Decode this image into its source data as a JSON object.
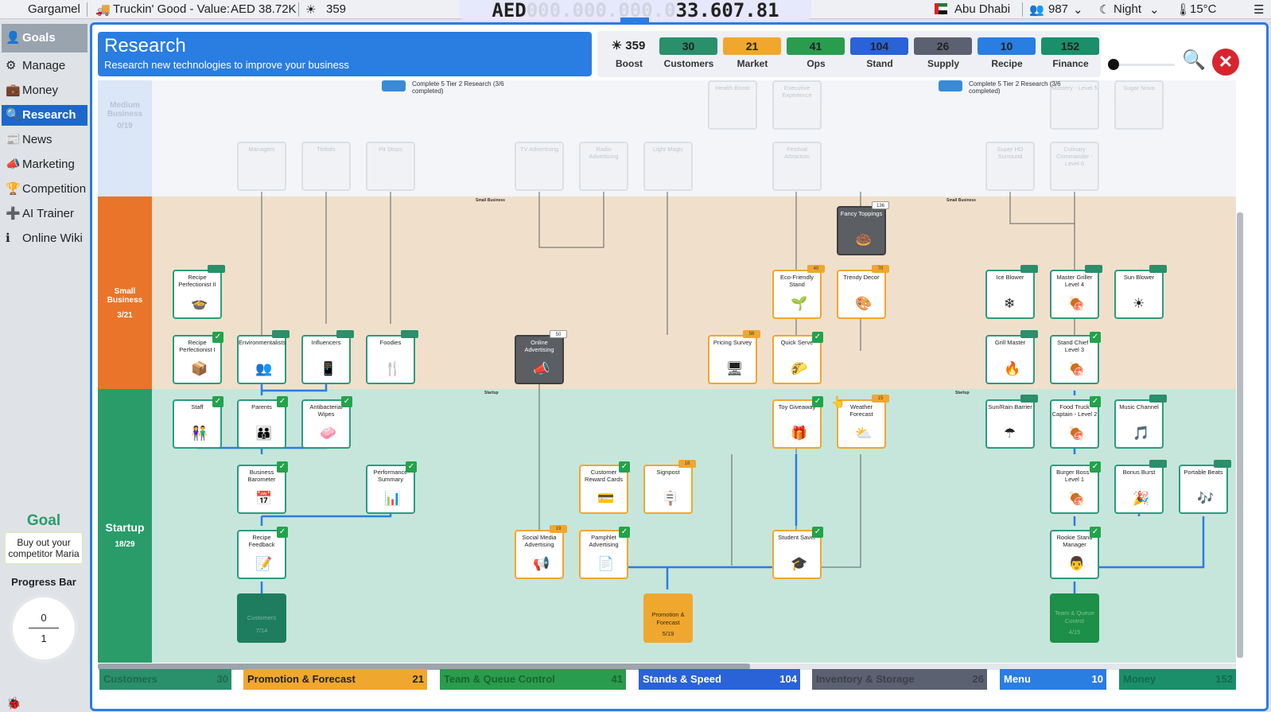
{
  "topbar": {
    "user": "Gargamel",
    "company": "Truckin' Good - Value:",
    "company_value": "AED 38.72K",
    "boost": "359",
    "money_prefix": "AED",
    "money_zeros": "000.000.000.0",
    "money_value": "33.607.81",
    "city": "Abu Dhabi",
    "visitors": "987",
    "time_of_day": "Night",
    "temperature": "15°C"
  },
  "sidebar": {
    "items": [
      {
        "label": "Goals",
        "icon": "person-icon"
      },
      {
        "label": "Manage",
        "icon": "gear-icon"
      },
      {
        "label": "Money",
        "icon": "wallet-icon"
      },
      {
        "label": "Research",
        "icon": "magnifier-icon"
      },
      {
        "label": "News",
        "icon": "newspaper-icon"
      },
      {
        "label": "Marketing",
        "icon": "megaphone-icon"
      },
      {
        "label": "Competition",
        "icon": "podium-icon"
      },
      {
        "label": "AI Trainer",
        "icon": "plus-icon"
      },
      {
        "label": "Online Wiki",
        "icon": "info-icon"
      }
    ],
    "goal_title": "Goal",
    "goal_text": "Buy out your competitor Maria",
    "progress_title": "Progress Bar",
    "progress_num": "0",
    "progress_den": "1"
  },
  "header": {
    "title": "Research",
    "subtitle": "Research new technologies to improve your business"
  },
  "stats": [
    {
      "value": "359",
      "label": "Boost",
      "color": "#eef0f5"
    },
    {
      "value": "30",
      "label": "Customers",
      "color": "#2a8f6b"
    },
    {
      "value": "21",
      "label": "Market",
      "color": "#f0a72e"
    },
    {
      "value": "41",
      "label": "Ops",
      "color": "#2a9c4e"
    },
    {
      "value": "104",
      "label": "Stand",
      "color": "#2a62d8"
    },
    {
      "value": "26",
      "label": "Supply",
      "color": "#5b6170"
    },
    {
      "value": "10",
      "label": "Recipe",
      "color": "#2a7de1"
    },
    {
      "value": "152",
      "label": "Finance",
      "color": "#1a8f6a"
    }
  ],
  "bands": {
    "medium": {
      "name": "Medium Business",
      "count": "0/19",
      "color": "#e8eef8"
    },
    "small": {
      "name": "Small Business",
      "count": "3/21",
      "color": "#e8752a"
    },
    "startup": {
      "name": "Startup",
      "count": "18/29",
      "color": "#2a9c6a"
    }
  },
  "ghost_nodes": [
    "Managers",
    "Tinfoils",
    "Pit Stops",
    "TV Advertising",
    "Radio Advertising",
    "Light Magic",
    "Festival Attraction",
    "Super HD Surround",
    "Culinary Commander - Level 6",
    "Health Boost",
    "Executive Experience",
    "Mastery - Level 5",
    "Sugar Nova"
  ],
  "nodes": [
    {
      "label": "Recipe Perfectionist II",
      "icon": "recipe-icon",
      "glyph": "🍲"
    },
    {
      "label": "Recipe Perfectionist I",
      "icon": "recipe-icon",
      "glyph": "📦"
    },
    {
      "label": "Environmentalists",
      "icon": "people-icon",
      "glyph": "👥"
    },
    {
      "label": "Influencers",
      "icon": "phone-icon",
      "glyph": "📱"
    },
    {
      "label": "Foodies",
      "icon": "fork-icon",
      "glyph": "🍴"
    },
    {
      "label": "Online Advertising",
      "icon": "megaphone-icon",
      "glyph": "📣"
    },
    {
      "label": "Pricing Survey",
      "icon": "monitor-icon",
      "glyph": "🖥"
    },
    {
      "label": "Quick Serve",
      "icon": "food-icon",
      "glyph": "🌮"
    },
    {
      "label": "Eco-Friendly Stand",
      "icon": "leaf-icon",
      "glyph": "🌱"
    },
    {
      "label": "Trendy Decor",
      "icon": "decor-icon",
      "glyph": "🎨"
    },
    {
      "label": "Fancy Toppings",
      "icon": "topping-icon",
      "glyph": "🍩"
    },
    {
      "label": "Ice Blower",
      "icon": "ice-icon",
      "glyph": "❄"
    },
    {
      "label": "Master Griller Level 4",
      "icon": "griller-icon",
      "glyph": "🍖"
    },
    {
      "label": "Sun Blower",
      "icon": "sun-icon",
      "glyph": "☀"
    },
    {
      "label": "Grill Master",
      "icon": "grill-icon",
      "glyph": "🔥"
    },
    {
      "label": "Stand Chief - Level 3",
      "icon": "chef-icon",
      "glyph": "🍖"
    },
    {
      "label": "Staff",
      "icon": "staff-icon",
      "glyph": "👫"
    },
    {
      "label": "Parents",
      "icon": "family-icon",
      "glyph": "👪"
    },
    {
      "label": "Antibacterial Wipes",
      "icon": "wipes-icon",
      "glyph": "🧼"
    },
    {
      "label": "Business Barometer",
      "icon": "calendar-icon",
      "glyph": "📅"
    },
    {
      "label": "Performance Summary",
      "icon": "chart-icon",
      "glyph": "📊"
    },
    {
      "label": "Recipe Feedback",
      "icon": "feedback-icon",
      "glyph": "📝"
    },
    {
      "label": "Customer Reward Cards",
      "icon": "card-icon",
      "glyph": "💳"
    },
    {
      "label": "Signpost",
      "icon": "signpost-icon",
      "glyph": "🪧"
    },
    {
      "label": "Social Media Advertising",
      "icon": "social-icon",
      "glyph": "📢"
    },
    {
      "label": "Pamphlet Advertising",
      "icon": "pamphlet-icon",
      "glyph": "📄"
    },
    {
      "label": "Toy Giveaway",
      "icon": "toy-icon",
      "glyph": "🎁"
    },
    {
      "label": "Weather Forecast",
      "icon": "weather-icon",
      "glyph": "⛅"
    },
    {
      "label": "Student Saver",
      "icon": "student-icon",
      "glyph": "🎓"
    },
    {
      "label": "Sun/Rain Barrier",
      "icon": "umbrella-icon",
      "glyph": "☂"
    },
    {
      "label": "Food Truck Captain - Level 2",
      "icon": "captain-icon",
      "glyph": "🍖"
    },
    {
      "label": "Music Channel",
      "icon": "music-icon",
      "glyph": "🎵"
    },
    {
      "label": "Burger Boss - Level 1",
      "icon": "burger-icon",
      "glyph": "🍖"
    },
    {
      "label": "Bonus Burst",
      "icon": "bonus-icon",
      "glyph": "🎉"
    },
    {
      "label": "Portable Beats",
      "icon": "speaker-icon",
      "glyph": "🎶"
    },
    {
      "label": "Rookie Stand Manager",
      "icon": "manager-icon",
      "glyph": "👨"
    }
  ],
  "costs": [
    "50",
    "40",
    "70",
    "136",
    "58",
    "18",
    "19",
    "15"
  ],
  "summaries": [
    {
      "label": "Customers",
      "count": "7/14"
    },
    {
      "label": "Promotion & Forecast",
      "count": "5/19"
    },
    {
      "label": "Team & Queue Control",
      "count": "4/15"
    }
  ],
  "band_notes": [
    "Complete 5 Tier 2 Research (3/6 completed)",
    "Small Business",
    "Startup"
  ],
  "bottom_tabs": [
    {
      "label": "Customers",
      "value": "30",
      "color": "#2a8f6b"
    },
    {
      "label": "Promotion & Forecast",
      "value": "21",
      "color": "#f0a72e"
    },
    {
      "label": "Team & Queue Control",
      "value": "41",
      "color": "#2a9c4e"
    },
    {
      "label": "Stands & Speed",
      "value": "104",
      "color": "#2a62d8"
    },
    {
      "label": "Inventory & Storage",
      "value": "26",
      "color": "#5b6170"
    },
    {
      "label": "Menu",
      "value": "10",
      "color": "#2a7de1"
    },
    {
      "label": "Money",
      "value": "152",
      "color": "#1a8f6a"
    }
  ]
}
